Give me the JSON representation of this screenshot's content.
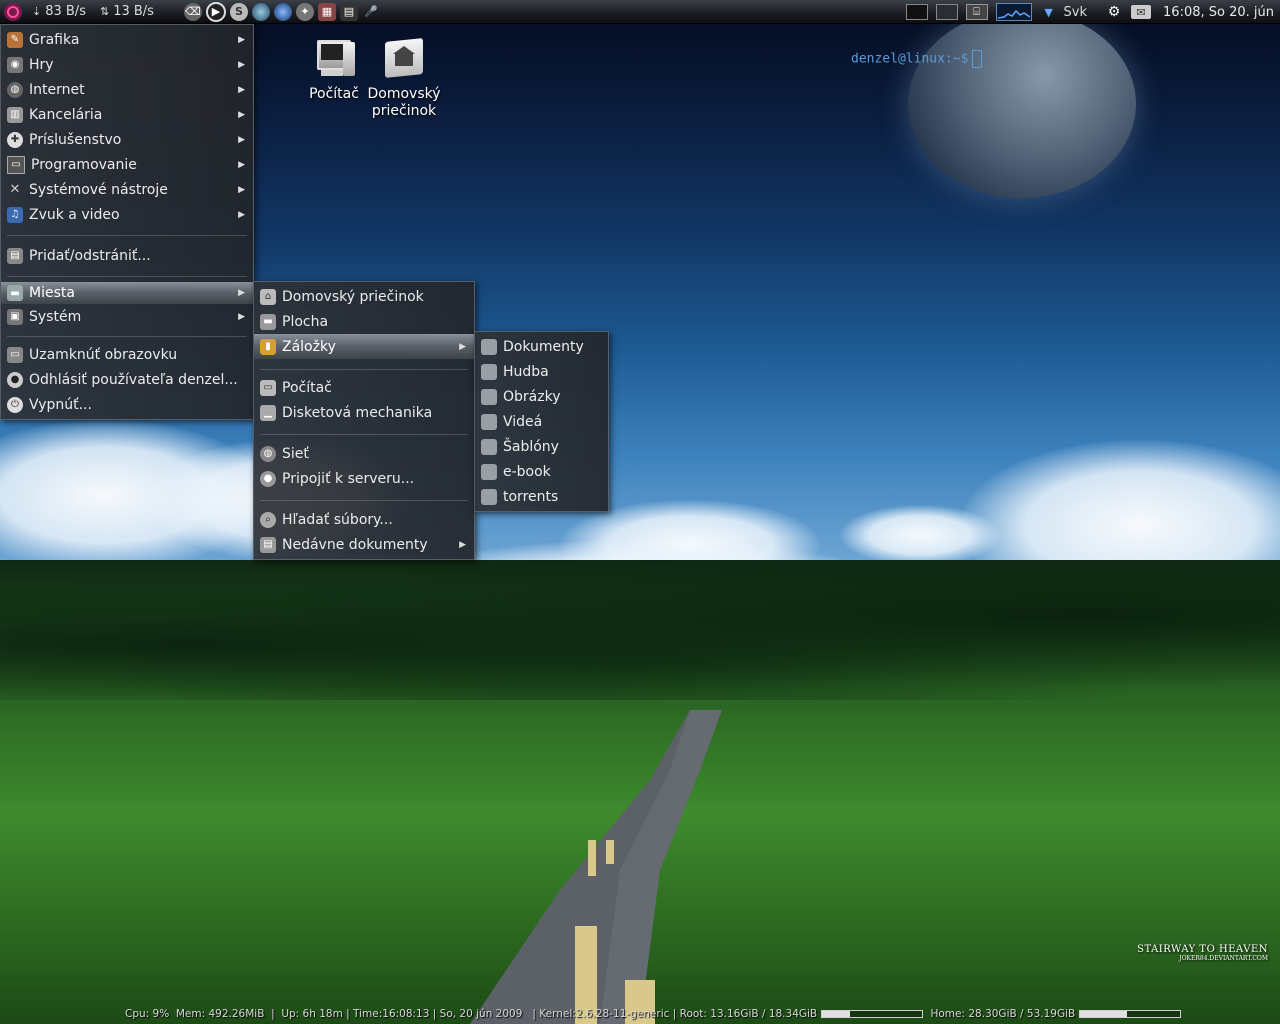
{
  "top_panel": {
    "net_down": "83 B/s",
    "net_up": "13 B/s",
    "keyboard_layout": "Svk",
    "clock": "16:08, So 20. jún"
  },
  "main_menu": {
    "items": [
      {
        "label": "Grafika",
        "icon": "graphics-icon"
      },
      {
        "label": "Hry",
        "icon": "gamepad-icon"
      },
      {
        "label": "Internet",
        "icon": "globe-icon"
      },
      {
        "label": "Kancelária",
        "icon": "office-icon"
      },
      {
        "label": "Príslušenstvo",
        "icon": "accessories-icon"
      },
      {
        "label": "Programovanie",
        "icon": "programming-icon"
      },
      {
        "label": "Systémové nástroje",
        "icon": "tools-icon"
      },
      {
        "label": "Zvuk a video",
        "icon": "multimedia-icon"
      },
      {
        "label": "Pridať/odstrániť...",
        "icon": "package-icon"
      },
      {
        "label": "Miesta",
        "icon": "folder-icon"
      },
      {
        "label": "Systém",
        "icon": "system-icon"
      },
      {
        "label": "Uzamknúť obrazovku",
        "icon": "lock-screen-icon"
      },
      {
        "label": "Odhlásiť používateľa denzel...",
        "icon": "logout-icon"
      },
      {
        "label": "Vypnúť...",
        "icon": "power-icon"
      }
    ]
  },
  "places_menu": {
    "items": [
      {
        "label": "Domovský priečinok"
      },
      {
        "label": "Plocha"
      },
      {
        "label": "Záložky"
      },
      {
        "label": "Počítač"
      },
      {
        "label": "Disketová mechanika"
      },
      {
        "label": "Sieť"
      },
      {
        "label": "Pripojiť k serveru..."
      },
      {
        "label": "Hľadať súbory..."
      },
      {
        "label": "Nedávne dokumenty"
      }
    ]
  },
  "bookmarks_menu": {
    "items": [
      {
        "label": "Dokumenty"
      },
      {
        "label": "Hudba"
      },
      {
        "label": "Obrázky"
      },
      {
        "label": "Videá"
      },
      {
        "label": "Šablóny"
      },
      {
        "label": "e-book"
      },
      {
        "label": "torrents"
      }
    ]
  },
  "desktop": {
    "icons": [
      {
        "label": "Počítač"
      },
      {
        "label": "Domovský priečinok"
      }
    ],
    "prompt": "denzel@linux:~$"
  },
  "conky": {
    "cpu": "Cpu: 9%",
    "mem": "Mem: 492.26MiB",
    "uptime": "Up: 6h 18m",
    "time": "Time:16:08:13",
    "date": "So, 20 jún 2009",
    "kernel": "Kernel:2.6.28-11-generic",
    "root": "Root: 13.16GiB / 18.34GiB",
    "root_fill": 0.28,
    "home": "Home: 28.30GiB / 53.19GiB",
    "home_fill": 0.47
  },
  "watermark": {
    "title": "STAIRWAY TO HEAVEN",
    "subtitle": "JOKER84.DEVIANTART.COM"
  }
}
